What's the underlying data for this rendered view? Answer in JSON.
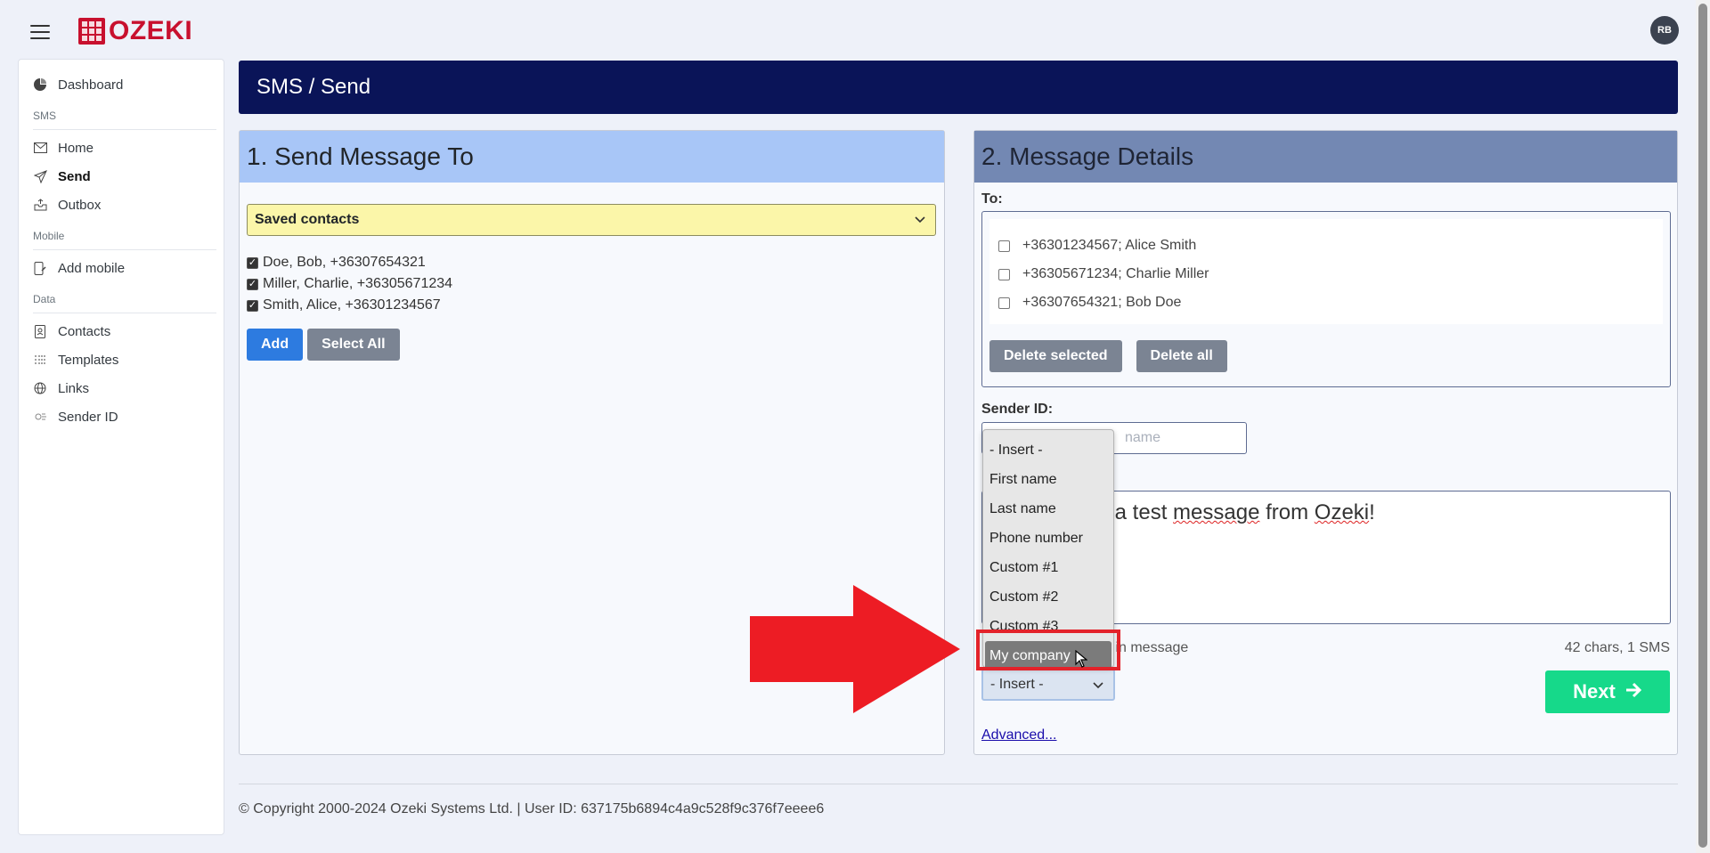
{
  "brand": {
    "logo_text": "OZEKI",
    "avatar_initials": "RB"
  },
  "sidebar": {
    "dashboard": "Dashboard",
    "sections": [
      {
        "title": "SMS",
        "items": [
          "Home",
          "Send",
          "Outbox"
        ]
      },
      {
        "title": "Mobile",
        "items": [
          "Add mobile"
        ]
      },
      {
        "title": "Data",
        "items": [
          "Contacts",
          "Templates",
          "Links",
          "Sender ID"
        ]
      }
    ]
  },
  "header": {
    "title": "SMS / Send"
  },
  "send_to": {
    "title": "1. Send Message To",
    "source_select": "Saved contacts",
    "contacts": [
      "Doe, Bob, +36307654321",
      "Miller, Charlie, +36305671234",
      "Smith, Alice, +36301234567"
    ],
    "add_label": "Add",
    "select_all_label": "Select All"
  },
  "details": {
    "title": "2. Message Details",
    "to_label": "To:",
    "recipients": [
      "+36301234567; Alice Smith",
      "+36305671234; Charlie Miller",
      "+36307654321; Bob Doe"
    ],
    "delete_selected": "Delete selected",
    "delete_all": "Delete all",
    "sender_label": "Sender ID:",
    "sender_placeholder": "name",
    "message_text_visible": "s a test ",
    "message_word1": "message",
    "message_mid": " from ",
    "message_word2": "Ozeki",
    "message_end": "!",
    "links_note": "ks in message",
    "char_count": "42 chars, 1 SMS",
    "insert_label": "- Insert -",
    "next_label": "Next",
    "advanced_label": "Advanced..."
  },
  "insert_dropdown": {
    "options": [
      "- Insert -",
      "First name",
      "Last name",
      "Phone number",
      "Custom #1",
      "Custom #2",
      "Custom #3",
      "My company"
    ],
    "selected": "My company"
  },
  "footer": {
    "text": "© Copyright 2000-2024 Ozeki Systems Ltd. | User ID: 637175b6894c4a9c528f9c376f7eeee6"
  },
  "colors": {
    "accent_red": "#e3222a",
    "header_navy": "#0a1458",
    "next_green": "#16d98a"
  }
}
